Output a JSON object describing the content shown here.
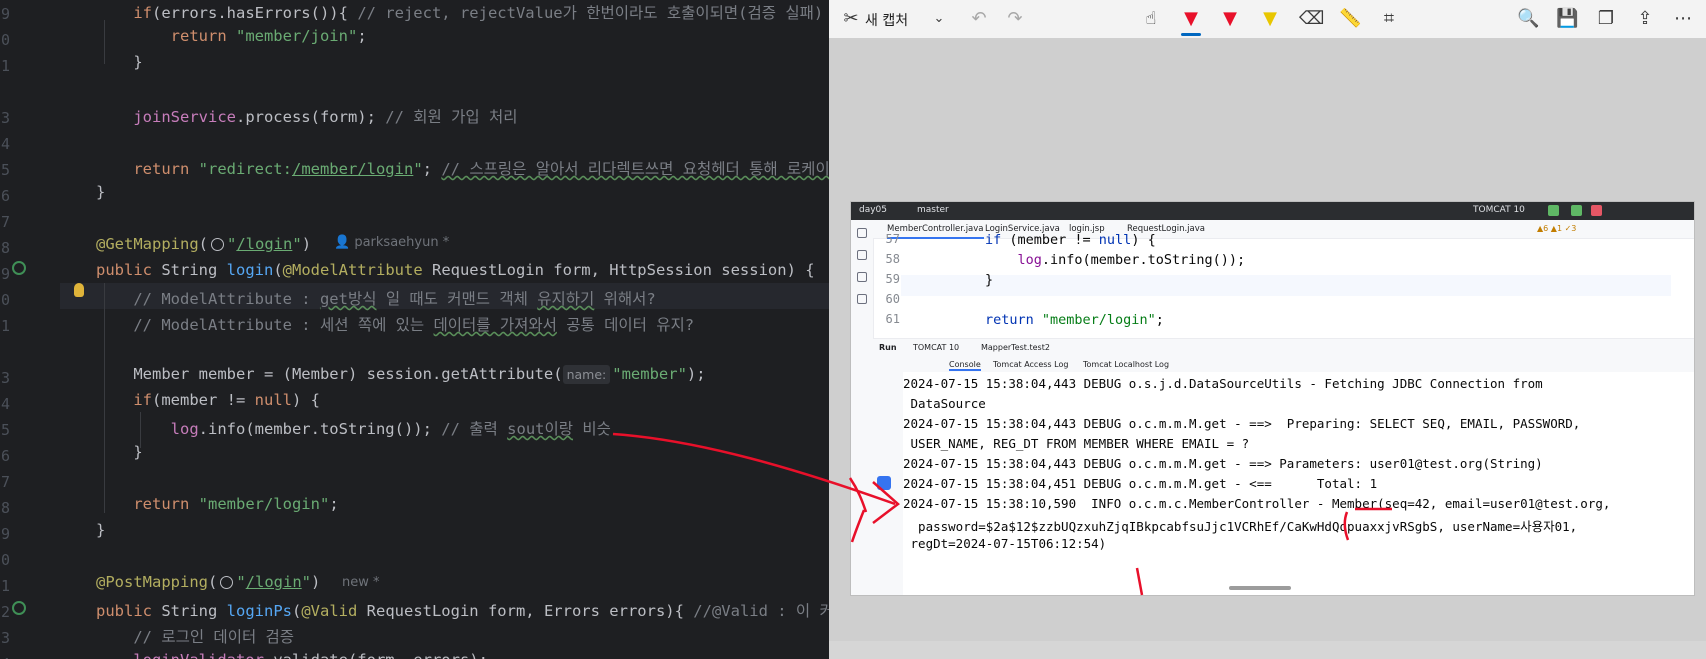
{
  "editor": {
    "line_numbers": [
      "9",
      "0",
      "1",
      "",
      "3",
      "4",
      "5",
      "6",
      "7",
      "8",
      "9",
      "0",
      "1",
      "",
      "3",
      "4",
      "5",
      "6",
      "7",
      "8",
      "9",
      "0",
      "1",
      "2",
      "3",
      "4"
    ],
    "lines": [
      {
        "indent": "    ",
        "parts": [
          {
            "c": "kw",
            "t": "if"
          },
          {
            "c": "",
            "t": "(errors.hasErrors()){ "
          },
          {
            "c": "cm",
            "t": "// reject, rejectValue가 한번이라도 호출이되면(검증 실패)"
          }
        ]
      },
      {
        "indent": "        ",
        "parts": [
          {
            "c": "kw",
            "t": "return "
          },
          {
            "c": "str",
            "t": "\"member/join\""
          },
          {
            "c": "",
            "t": ";"
          }
        ]
      },
      {
        "indent": "    ",
        "parts": [
          {
            "c": "",
            "t": "}"
          }
        ]
      },
      {
        "indent": "",
        "parts": []
      },
      {
        "indent": "    ",
        "parts": [
          {
            "c": "fld",
            "t": "joinService"
          },
          {
            "c": "",
            "t": ".process(form); "
          },
          {
            "c": "cm",
            "t": "// 회원 가입 처리"
          }
        ]
      },
      {
        "indent": "",
        "parts": []
      },
      {
        "indent": "    ",
        "parts": [
          {
            "c": "kw",
            "t": "return "
          },
          {
            "c": "str",
            "t": "\"redirect:"
          },
          {
            "c": "strl",
            "t": "/member/login"
          },
          {
            "c": "str",
            "t": "\""
          },
          {
            "c": "",
            "t": "; "
          },
          {
            "c": "cmu",
            "t": "// 스프링은 알아서 리다렉트쓰면 요청헤더 통해 로케이"
          }
        ]
      },
      {
        "indent": "",
        "parts": [
          {
            "c": "",
            "t": "}"
          }
        ]
      },
      {
        "indent": "",
        "parts": []
      },
      {
        "indent": "",
        "parts": [
          {
            "c": "an",
            "t": "@GetMapping"
          },
          {
            "c": "",
            "t": "("
          },
          {
            "c": "globe",
            "t": ""
          },
          {
            "c": "str",
            "t": "\""
          },
          {
            "c": "strl",
            "t": "/login"
          },
          {
            "c": "str",
            "t": "\""
          },
          {
            "c": "",
            "t": ")"
          }
        ]
      },
      {
        "indent": "",
        "parts": [
          {
            "c": "kw",
            "t": "public "
          },
          {
            "c": "",
            "t": "String "
          },
          {
            "c": "fn",
            "t": "login"
          },
          {
            "c": "",
            "t": "("
          },
          {
            "c": "an",
            "t": "@ModelAttribute "
          },
          {
            "c": "",
            "t": "RequestLogin form, HttpSession session) {"
          }
        ]
      },
      {
        "indent": "    ",
        "parts": [
          {
            "c": "cm",
            "t": "// ModelAttribute : "
          },
          {
            "c": "cmu",
            "t": "get방식"
          },
          {
            "c": "cm",
            "t": " 일 때도 커맨드 객체 "
          },
          {
            "c": "cmu",
            "t": "유지하기"
          },
          {
            "c": "cm",
            "t": " 위해서?"
          }
        ]
      },
      {
        "indent": "    ",
        "parts": [
          {
            "c": "cm",
            "t": "// ModelAttribute : 세션 쪽에 있는 "
          },
          {
            "c": "cmu",
            "t": "데이터를 가져와서"
          },
          {
            "c": "cm",
            "t": " 공통 데이터 유지?"
          }
        ]
      },
      {
        "indent": "",
        "parts": []
      },
      {
        "indent": "    ",
        "parts": [
          {
            "c": "",
            "t": "Member member = (Member) session.getAttribute("
          },
          {
            "c": "hint",
            "t": "name:"
          },
          {
            "c": "str",
            "t": "\"member\""
          },
          {
            "c": "",
            "t": ");"
          }
        ]
      },
      {
        "indent": "    ",
        "parts": [
          {
            "c": "kw",
            "t": "if"
          },
          {
            "c": "",
            "t": "(member != "
          },
          {
            "c": "kw",
            "t": "null"
          },
          {
            "c": "",
            "t": ") {"
          }
        ]
      },
      {
        "indent": "        ",
        "parts": [
          {
            "c": "fld",
            "t": "log"
          },
          {
            "c": "",
            "t": ".info(member.toString()); "
          },
          {
            "c": "cm",
            "t": "// 출력 "
          },
          {
            "c": "cmu",
            "t": "sout이랑"
          },
          {
            "c": "cm",
            "t": " 비슷"
          }
        ]
      },
      {
        "indent": "    ",
        "parts": [
          {
            "c": "",
            "t": "}"
          }
        ]
      },
      {
        "indent": "",
        "parts": []
      },
      {
        "indent": "    ",
        "parts": [
          {
            "c": "kw",
            "t": "return "
          },
          {
            "c": "str",
            "t": "\"member/login\""
          },
          {
            "c": "",
            "t": ";"
          }
        ]
      },
      {
        "indent": "",
        "parts": [
          {
            "c": "",
            "t": "}"
          }
        ]
      },
      {
        "indent": "",
        "parts": []
      },
      {
        "indent": "",
        "parts": [
          {
            "c": "an",
            "t": "@PostMapping"
          },
          {
            "c": "",
            "t": "("
          },
          {
            "c": "globe",
            "t": ""
          },
          {
            "c": "str",
            "t": "\""
          },
          {
            "c": "strl",
            "t": "/login"
          },
          {
            "c": "str",
            "t": "\""
          },
          {
            "c": "",
            "t": ")"
          }
        ]
      },
      {
        "indent": "",
        "parts": [
          {
            "c": "kw",
            "t": "public "
          },
          {
            "c": "",
            "t": "String "
          },
          {
            "c": "fn",
            "t": "loginPs"
          },
          {
            "c": "",
            "t": "("
          },
          {
            "c": "an",
            "t": "@Valid "
          },
          {
            "c": "",
            "t": "RequestLogin form, Errors errors){ "
          },
          {
            "c": "cm",
            "t": "//@Valid : 이 커맨"
          }
        ]
      },
      {
        "indent": "    ",
        "parts": [
          {
            "c": "cm",
            "t": "// 로그인 데이터 검증"
          }
        ]
      },
      {
        "indent": "    ",
        "parts": [
          {
            "c": "fld",
            "t": "loginValidator"
          },
          {
            "c": "",
            "t": ".validate(form, errors);"
          }
        ]
      }
    ],
    "author_get": "parksaehyun *",
    "author_post": "new *"
  },
  "snip": {
    "new_capture": "새 캡처",
    "tools": [
      "touch-write-icon",
      "ballpoint-pen-icon",
      "red-pen-icon",
      "highlighter-icon",
      "eraser-icon",
      "ruler-icon",
      "crop-icon"
    ],
    "right_tools": [
      "zoom-icon",
      "save-icon",
      "copy-icon",
      "share-icon",
      "more-icon"
    ]
  },
  "shot": {
    "project": "day05",
    "branch": "master",
    "run_config": "TOMCAT 10",
    "tabs": [
      "MemberController.java",
      "LoginService.java",
      "login.jsp",
      "RequestLogin.java"
    ],
    "warnings": "▲6 ▲1 ✓3",
    "line_numbers": [
      "57",
      "58",
      "59",
      "60",
      "61"
    ],
    "code": [
      [
        {
          "c": "k",
          "t": "if "
        },
        {
          "c": "",
          "t": "(member != "
        },
        {
          "c": "k",
          "t": "null"
        },
        {
          "c": "",
          "t": ") {"
        }
      ],
      [
        {
          "c": "",
          "t": "    "
        },
        {
          "c": "f",
          "t": "log"
        },
        {
          "c": "",
          "t": ".info(member.toString());"
        }
      ],
      [
        {
          "c": "",
          "t": "}"
        }
      ],
      [],
      [
        {
          "c": "k",
          "t": "return "
        },
        {
          "c": "s",
          "t": "\"member/login\""
        },
        {
          "c": "",
          "t": ";"
        }
      ]
    ],
    "run_label": "Run",
    "run_tabs": [
      "TOMCAT 10",
      "MapperTest.test2"
    ],
    "console_tabs": [
      "Console",
      "Tomcat Access Log",
      "Tomcat Localhost Log"
    ],
    "console": [
      "2024-07-15 15:38:04,443 DEBUG o.s.j.d.DataSourceUtils - Fetching JDBC Connection from",
      " DataSource",
      "2024-07-15 15:38:04,443 DEBUG o.c.m.m.M.get - ==>  Preparing: SELECT SEQ, EMAIL, PASSWORD,",
      " USER_NAME, REG_DT FROM MEMBER WHERE EMAIL = ?",
      "2024-07-15 15:38:04,443 DEBUG o.c.m.m.M.get - ==> Parameters: user01@test.org(String)",
      "2024-07-15 15:38:04,451 DEBUG o.c.m.m.M.get - <==      Total: 1",
      "2024-07-15 15:38:10,590  INFO o.c.m.c.MemberController - Member(seq=42, email=user01@test.org,",
      "  password=$2a$12$zzbUQzxuhZjqIBkpcabfsuJjc1VCRhEf/CaKwHdQqpuaxxjvRSgbS, userName=사용자01,",
      " regDt=2024-07-15T06:12:54)"
    ]
  },
  "colors": {
    "annotation_red": "#e8102a",
    "accent": "#0067c0"
  }
}
